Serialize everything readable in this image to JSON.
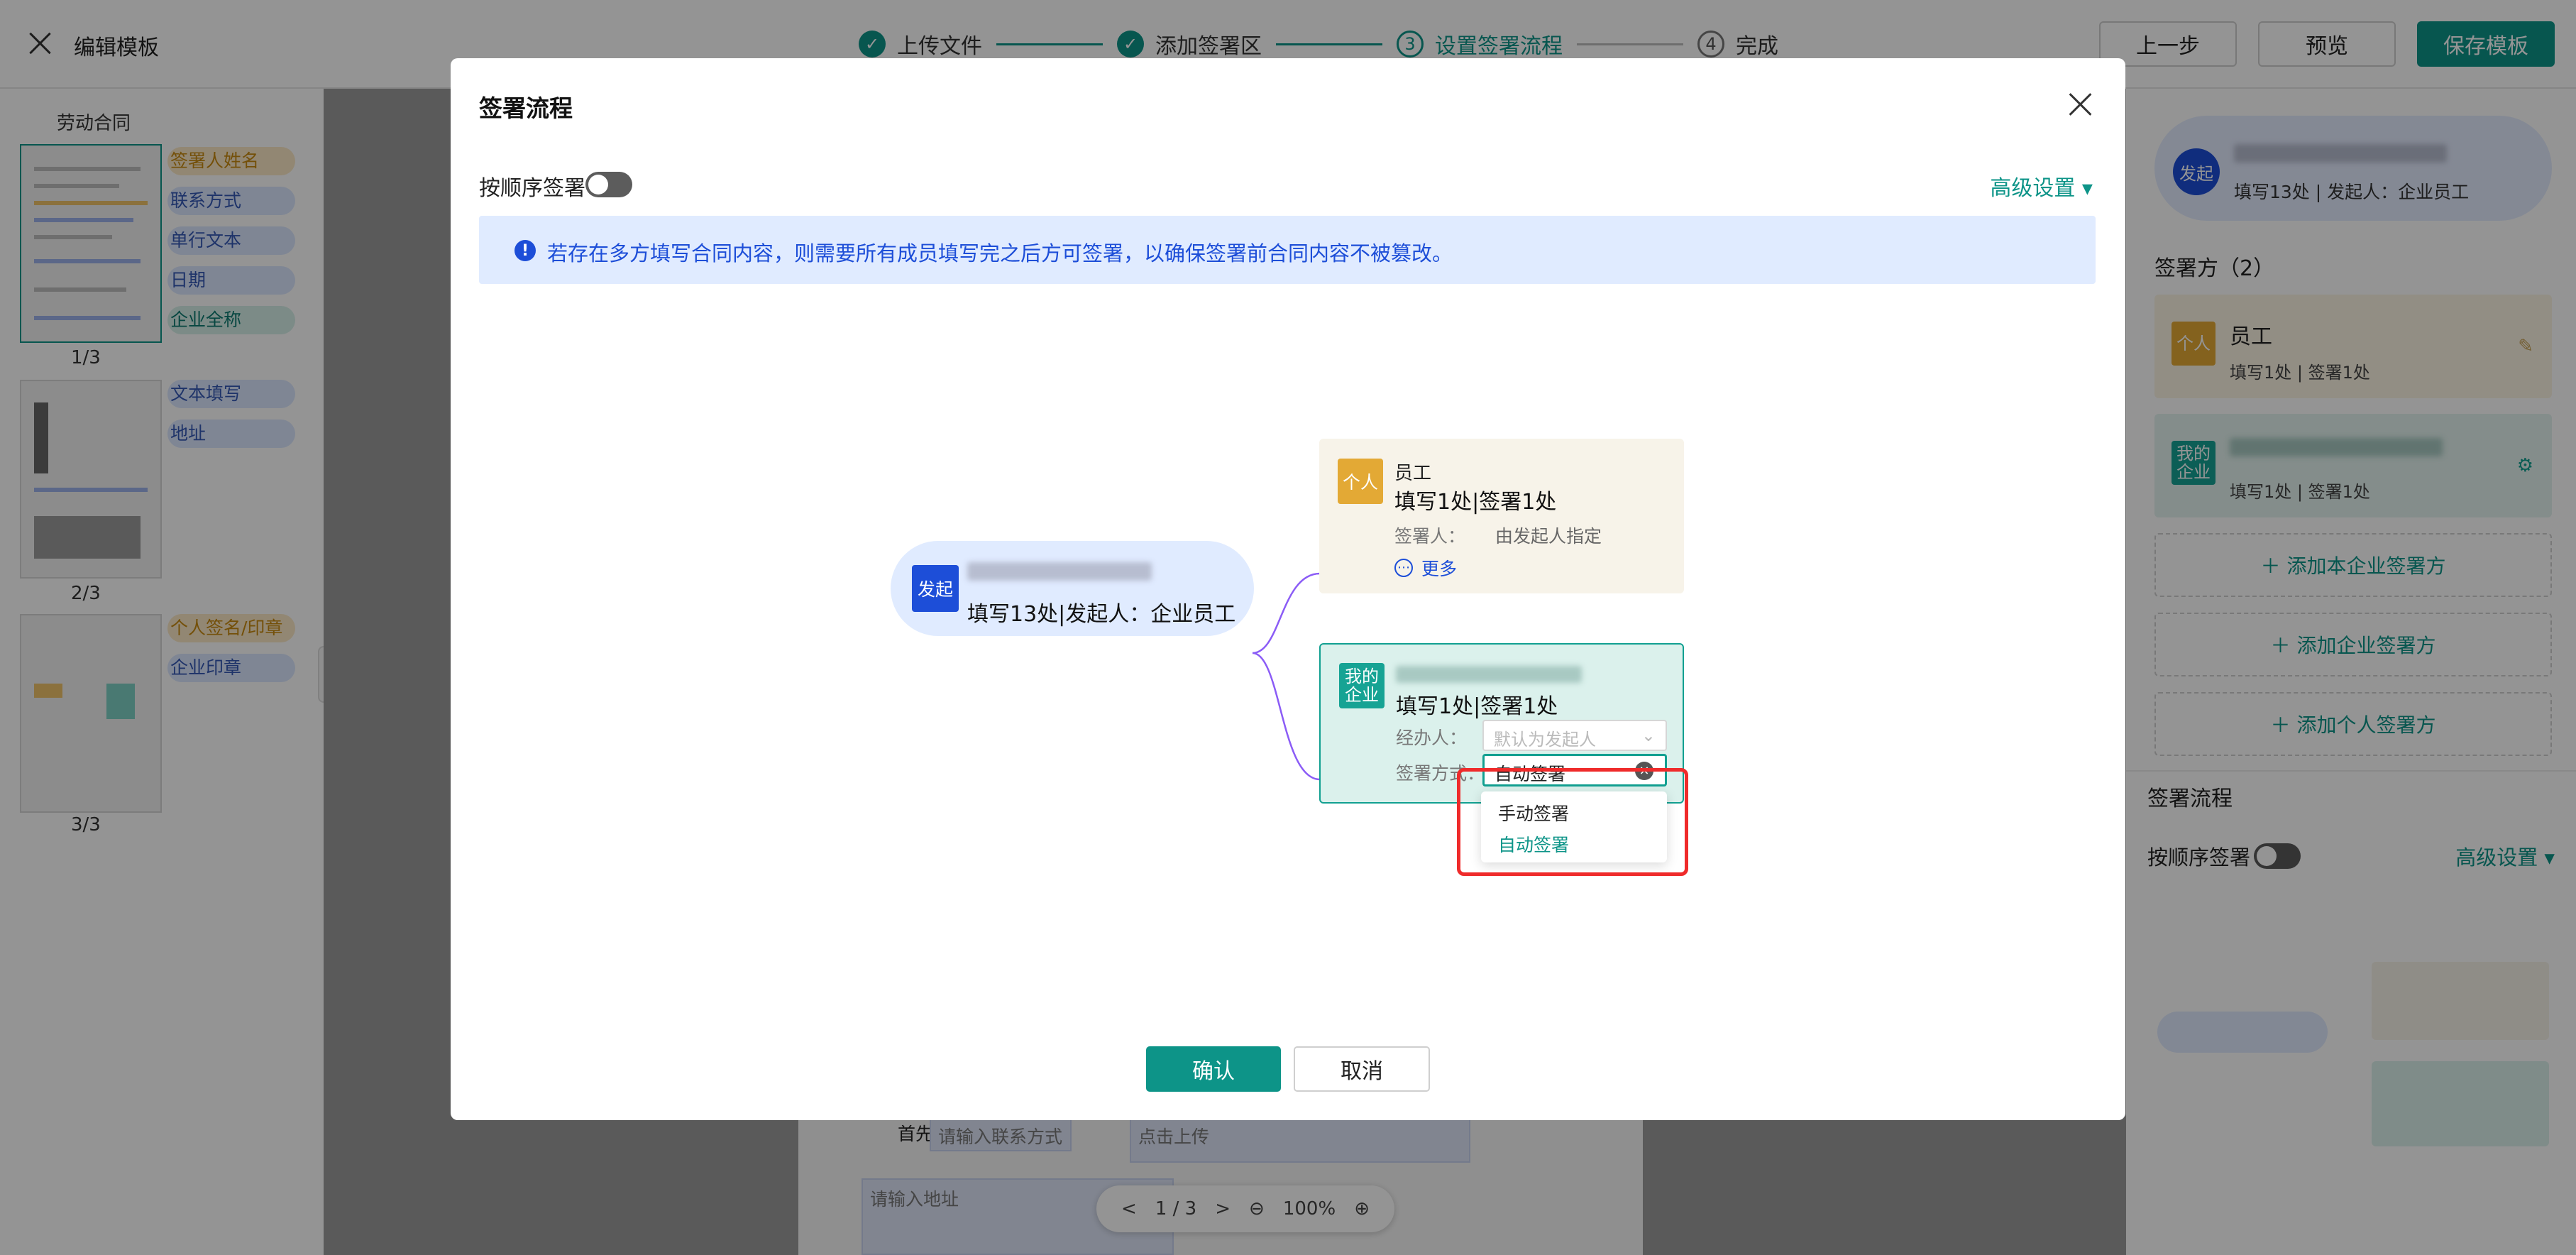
{
  "app": {
    "title": "编辑模板",
    "steps": [
      {
        "num": "✓",
        "label": "上传文件",
        "state": "done"
      },
      {
        "num": "✓",
        "label": "添加签署区",
        "state": "done"
      },
      {
        "num": "3",
        "label": "设置签署流程",
        "state": "active"
      },
      {
        "num": "4",
        "label": "完成",
        "state": "todo"
      }
    ],
    "buttons": {
      "prev": "上一步",
      "preview": "预览",
      "save": "保存模板"
    }
  },
  "left_panel": {
    "title": "劳动合同",
    "pages": [
      "1/3",
      "2/3",
      "3/3"
    ],
    "fields_p1": [
      "签署人姓名",
      "联系方式",
      "单行文本",
      "日期",
      "企业全称"
    ],
    "fields_p2": [
      "文本填写",
      "地址"
    ],
    "fields_p3": [
      "个人签名/印章",
      "企业印章"
    ],
    "collapse_icon": "«"
  },
  "canvas": {
    "label": "首先:",
    "contact_placeholder": "请输入联系方式",
    "upload_placeholder": "点击上传",
    "address_placeholder": "请输入地址",
    "pager": {
      "prev": "<",
      "current": "1 / 3",
      "next": ">",
      "zoom": "100%"
    }
  },
  "right_panel": {
    "initiator_badge": "发起",
    "initiator_sub": "填写13处 | 发起人：企业员工",
    "parties_title": "签署方（2）",
    "party_person": {
      "badge": "个人",
      "name": "员工",
      "sub": "填写1处 | 签署1处"
    },
    "party_ent": {
      "badge": "我的\n企业",
      "sub": "填写1处 | 签署1处"
    },
    "add_buttons": [
      "＋ 添加本企业签署方",
      "＋ 添加企业签署方",
      "＋ 添加个人签署方"
    ],
    "flow_title": "签署流程",
    "seq_label": "按顺序签署",
    "advanced": "高级设置 ▾"
  },
  "modal": {
    "title": "签署流程",
    "seq_label": "按顺序签署",
    "advanced": "高级设置 ▾",
    "notice": "若存在多方填写合同内容，则需要所有成员填写完之后方可签署，以确保签署前合同内容不被篡改。",
    "notice_icon": "!",
    "start": {
      "badge": "发起",
      "text": "填写13处|发起人：企业员工"
    },
    "person": {
      "badge": "个人",
      "name": "员工",
      "title": "填写1处|签署1处",
      "signer_label": "签署人：",
      "signer_value": "由发起人指定",
      "more": "更多"
    },
    "enterprise": {
      "badge": "我的\n企业",
      "title": "填写1处|签署1处",
      "handler_label": "经办人：",
      "handler_placeholder": "默认为发起人",
      "method_label": "签署方式：",
      "method_value": "自动签署"
    },
    "dropdown": {
      "options": [
        "手动签署",
        "自动签署"
      ],
      "selected": "自动签署"
    },
    "confirm": "确认",
    "cancel": "取消"
  },
  "colors": {
    "accent": "#0d9488",
    "primary_blue": "#1d4ed8",
    "highlight_red": "#ef2b2b",
    "person_orange": "#e3a935"
  }
}
